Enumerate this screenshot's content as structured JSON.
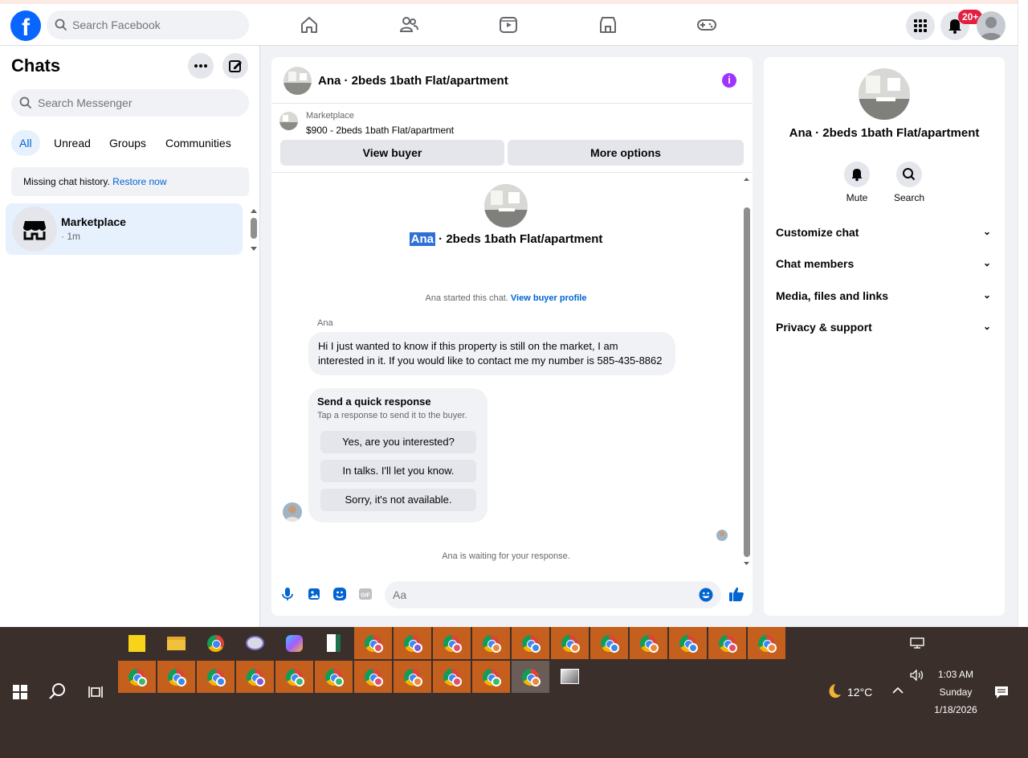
{
  "topbar": {
    "search_placeholder": "Search Facebook",
    "notifications_badge": "20+"
  },
  "sidebar": {
    "title": "Chats",
    "search_placeholder": "Search Messenger",
    "filters": [
      "All",
      "Unread",
      "Groups",
      "Communities"
    ],
    "restore_text": "Missing chat history.",
    "restore_link": "Restore now",
    "chats": [
      {
        "name": "Marketplace",
        "time": "· 1m"
      }
    ]
  },
  "chat": {
    "title": "Ana · 2beds 1bath Flat/apartment",
    "marketplace_label": "Marketplace",
    "listing": "$900 - 2beds 1bath Flat/apartment",
    "view_buyer": "View buyer",
    "more_options": "More options",
    "center_name_first": "Ana",
    "center_name_rest": " · 2beds 1bath Flat/apartment",
    "started_text": "Ana started this chat.",
    "view_buyer_profile": "View buyer profile",
    "sender": "Ana",
    "message": "Hi I just wanted to know if this property is still on the market, I am interested in it. If you would like to contact me my number is 585-435-8862",
    "quick_title": "Send a quick response",
    "quick_subtitle": "Tap a response to send it to the buyer.",
    "quick_responses": [
      "Yes, are you interested?",
      "In talks. I'll let you know.",
      "Sorry, it's not available."
    ],
    "waiting": "Ana is waiting for your response.",
    "composer_placeholder": "Aa"
  },
  "right_panel": {
    "name": "Ana · 2beds 1bath Flat/apartment",
    "mute": "Mute",
    "search": "Search",
    "sections": [
      "Customize chat",
      "Chat members",
      "Media, files and links",
      "Privacy & support"
    ]
  },
  "taskbar": {
    "weather": "12°C",
    "time": "1:03 AM",
    "day": "Sunday",
    "date": "1/18/2026"
  },
  "colors": {
    "brand": "#0866ff",
    "messenger_blue": "#0064d1",
    "info_purple": "#a033ff",
    "badge_red": "#e41e3f"
  }
}
